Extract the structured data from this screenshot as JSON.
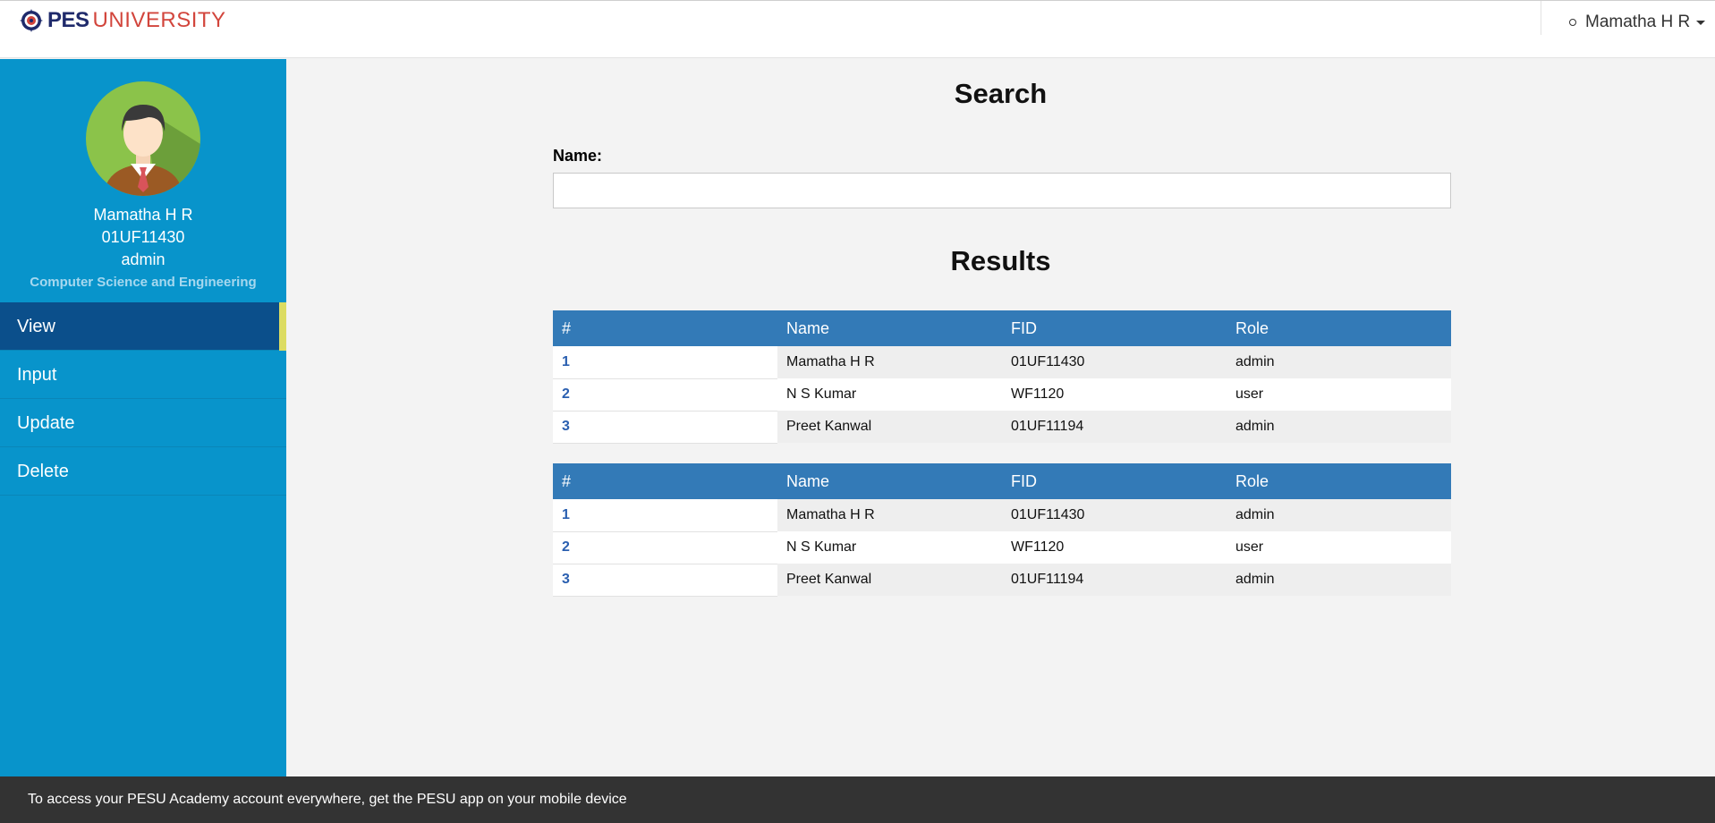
{
  "header": {
    "logo_pes": "PES",
    "logo_university": "UNIVERSITY",
    "user_name": "Mamatha H R"
  },
  "sidebar": {
    "profile": {
      "name": "Mamatha H R",
      "id": "01UF11430",
      "role": "admin",
      "department": "Computer Science and Engineering"
    },
    "nav": [
      {
        "label": "View",
        "active": true
      },
      {
        "label": "Input",
        "active": false
      },
      {
        "label": "Update",
        "active": false
      },
      {
        "label": "Delete",
        "active": false
      }
    ]
  },
  "main": {
    "search_title": "Search",
    "name_label": "Name:",
    "name_value": "",
    "results_title": "Results",
    "tables": [
      {
        "headers": [
          "#",
          "Name",
          "FID",
          "Role"
        ],
        "rows": [
          {
            "index": "1",
            "name": "Mamatha H R",
            "fid": "01UF11430",
            "role": "admin"
          },
          {
            "index": "2",
            "name": "N S Kumar",
            "fid": "WF1120",
            "role": "user"
          },
          {
            "index": "3",
            "name": "Preet Kanwal",
            "fid": "01UF11194",
            "role": "admin"
          }
        ]
      },
      {
        "headers": [
          "#",
          "Name",
          "FID",
          "Role"
        ],
        "rows": [
          {
            "index": "1",
            "name": "Mamatha H R",
            "fid": "01UF11430",
            "role": "admin"
          },
          {
            "index": "2",
            "name": "N S Kumar",
            "fid": "WF1120",
            "role": "user"
          },
          {
            "index": "3",
            "name": "Preet Kanwal",
            "fid": "01UF11194",
            "role": "admin"
          }
        ]
      }
    ]
  },
  "banner": {
    "text": "To access your PESU Academy account everywhere, get the PESU app on your mobile device"
  },
  "colors": {
    "sidebar": "#0894cb",
    "nav_active": "#0b4f8b",
    "active_marker": "#dcdc62",
    "table_header": "#337ab7",
    "banner": "#333333",
    "logo_blue": "#1f2a6b",
    "logo_red": "#d2453c"
  },
  "icons": {
    "logo": "pes-compass-icon",
    "user_status": "circle-icon",
    "dropdown": "caret-down-icon",
    "avatar": "male-user-avatar-icon"
  }
}
